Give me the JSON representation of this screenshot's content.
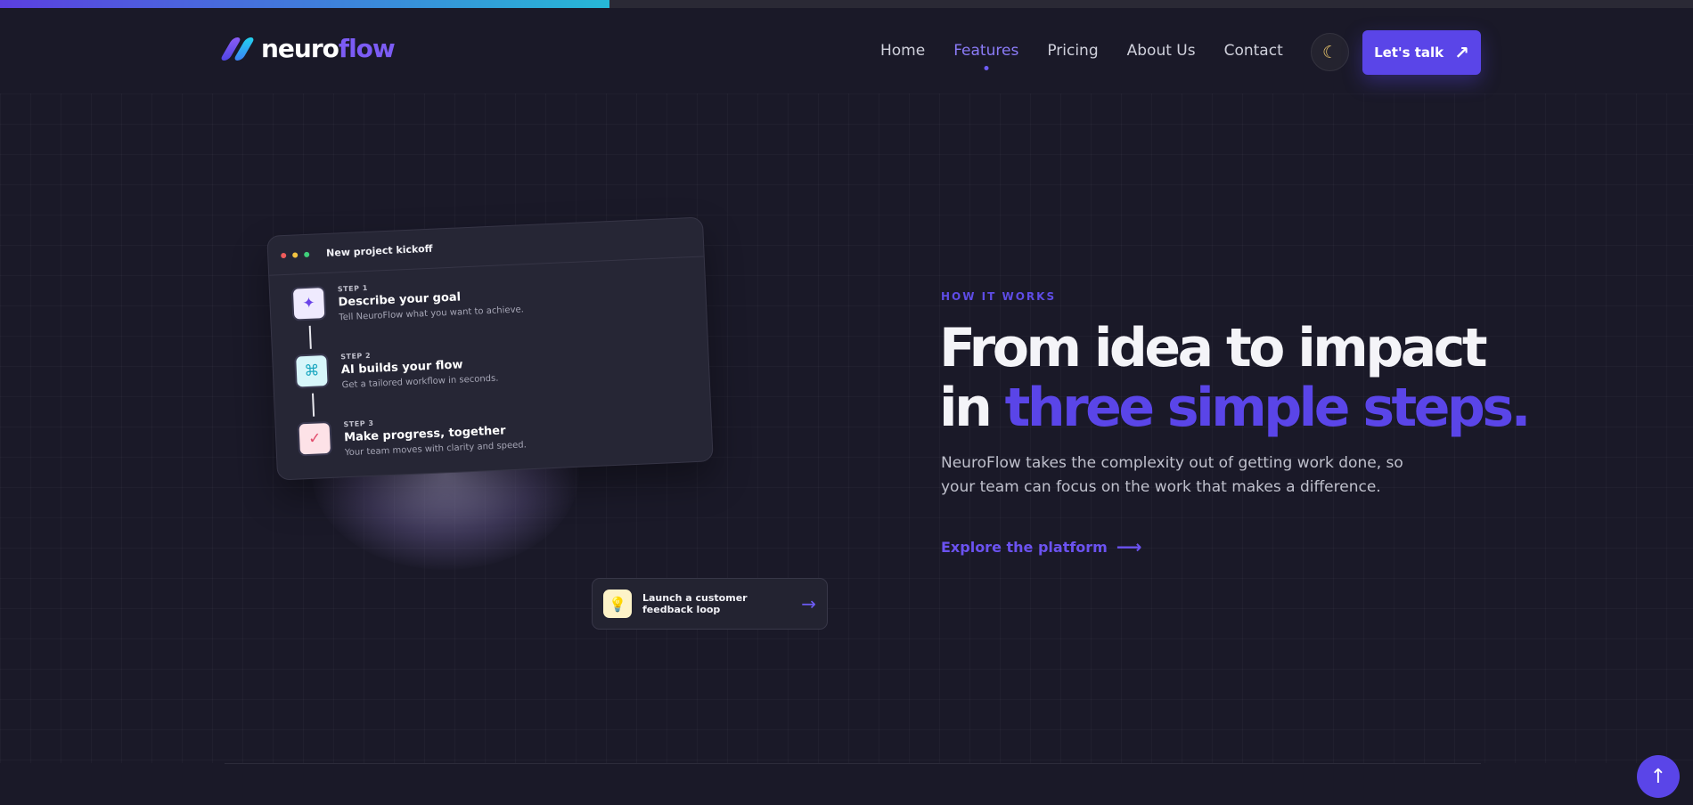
{
  "scroll_progress_percent": 36,
  "brand": {
    "name_part1": "neuro",
    "name_part2": "flow"
  },
  "nav": {
    "items": [
      {
        "label": "Home",
        "active": false
      },
      {
        "label": "Features",
        "active": true
      },
      {
        "label": "Pricing",
        "active": false
      },
      {
        "label": "About Us",
        "active": false
      },
      {
        "label": "Contact",
        "active": false
      }
    ],
    "theme_toggle_icon": "moon-icon",
    "cta_label": "Let's talk",
    "cta_icon": "arrow-up-right-icon"
  },
  "illustration": {
    "card_title": "New project kickoff",
    "steps": [
      {
        "label": "STEP 1",
        "title": "Describe your goal",
        "desc": "Tell NeuroFlow what you want to achieve.",
        "icon": "sparkle-icon"
      },
      {
        "label": "STEP 2",
        "title": "AI builds your flow",
        "desc": "Get a tailored workflow in seconds.",
        "icon": "command-icon"
      },
      {
        "label": "STEP 3",
        "title": "Make progress, together",
        "desc": "Your team moves with clarity and speed.",
        "icon": "check-icon"
      }
    ],
    "toast": {
      "text": "Launch a customer feedback loop",
      "icon": "lightbulb-icon"
    }
  },
  "hero": {
    "eyebrow": "HOW IT WORKS",
    "headline_line1": "From idea to impact",
    "headline_line2_plain": "in ",
    "headline_line2_accent": "three simple steps.",
    "lead": "NeuroFlow takes the complexity out of getting work done, so your team can focus on the work that makes a difference.",
    "link_label": "Explore the platform"
  },
  "scroll_top_icon": "arrow-up-icon",
  "colors": {
    "accent": "#5a45e8",
    "background": "#1a1928",
    "progress_start": "#5b3fe0",
    "progress_end": "#26b8d6"
  }
}
